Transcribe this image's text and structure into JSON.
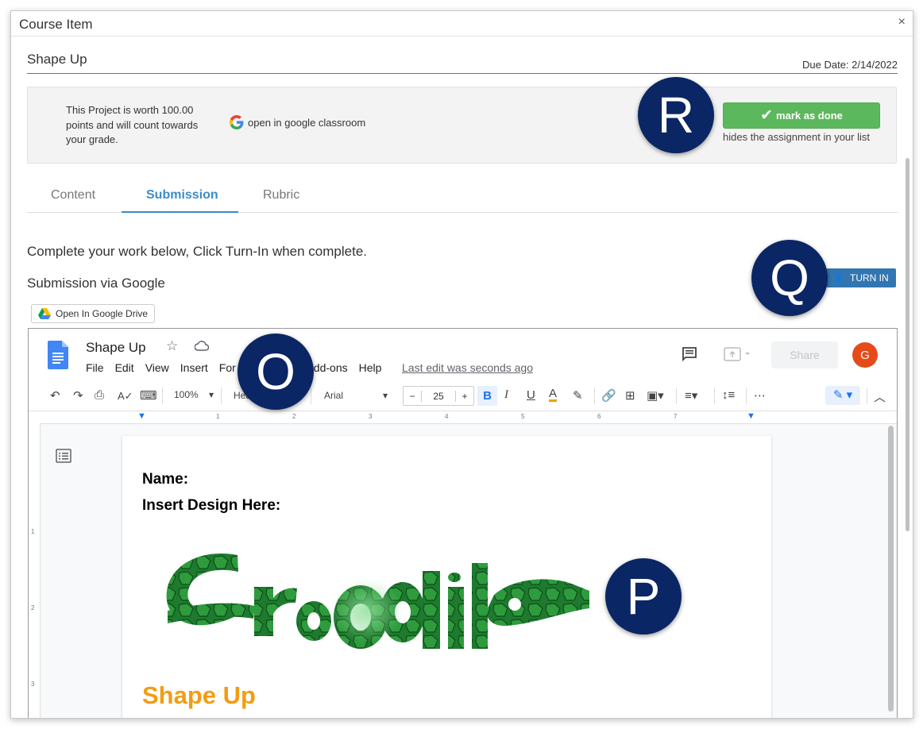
{
  "modal": {
    "title": "Course Item",
    "close": "×"
  },
  "item": {
    "title": "Shape Up",
    "due_date": "Due Date: 2/14/2022"
  },
  "info": {
    "worth": "This Project is worth 100.00 points and will count towards your grade.",
    "google_link": "open in google classroom",
    "done_button": "mark as done",
    "done_hint": "hides the assignment in your list"
  },
  "tabs": [
    {
      "label": "Content"
    },
    {
      "label": "Submission"
    },
    {
      "label": "Rubric"
    }
  ],
  "submission": {
    "instructions": "Complete your work below, Click Turn-In when complete.",
    "via": "Submission via Google",
    "turn_in": "TURN IN",
    "open_drive": "Open In Google Drive"
  },
  "doc": {
    "name": "Shape Up",
    "menu": [
      "File",
      "Edit",
      "View",
      "Insert",
      "For",
      "",
      "dd-ons",
      "Help"
    ],
    "last_edit": "Last edit was seconds ago",
    "share": "Share",
    "avatar": "G",
    "zoom": "100%",
    "style": "Hea",
    "font": "Arial",
    "font_size": "25",
    "ruler": [
      "1",
      "2",
      "3",
      "4",
      "5",
      "6",
      "7"
    ],
    "vruler": [
      "1",
      "2",
      "3"
    ],
    "lines": {
      "name": "Name:",
      "design": "Insert Design Here:",
      "heading": "Shape Up"
    },
    "image_text": "Crocodile"
  },
  "markers": {
    "R": "R",
    "Q": "Q",
    "O": "O",
    "P": "P"
  },
  "colors": {
    "accent_green": "#5cb85c",
    "tab_blue": "#3a8ccc",
    "turn_in_blue": "#3276b1",
    "marker_navy": "#0b2664",
    "heading_orange": "#f39c12"
  }
}
